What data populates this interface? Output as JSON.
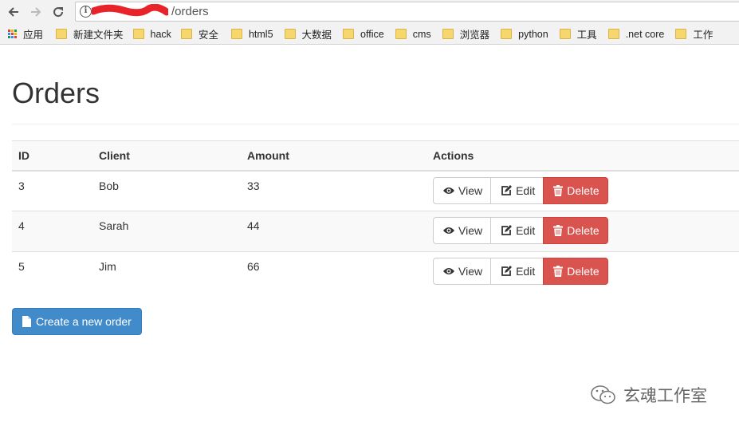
{
  "browser": {
    "url_path": "/orders",
    "bookmarks": [
      {
        "label": "应用",
        "icon": "apps-grid-icon"
      },
      {
        "label": "新建文件夹",
        "icon": "folder-icon"
      },
      {
        "label": "hack",
        "icon": "folder-icon"
      },
      {
        "label": "安全",
        "icon": "folder-icon"
      },
      {
        "label": "html5",
        "icon": "folder-icon"
      },
      {
        "label": "大数据",
        "icon": "folder-icon"
      },
      {
        "label": "office",
        "icon": "folder-icon"
      },
      {
        "label": "cms",
        "icon": "folder-icon"
      },
      {
        "label": "浏览器",
        "icon": "folder-icon"
      },
      {
        "label": "python",
        "icon": "folder-icon"
      },
      {
        "label": "工具",
        "icon": "folder-icon"
      },
      {
        "label": ".net core",
        "icon": "folder-icon"
      },
      {
        "label": "工作",
        "icon": "folder-icon"
      }
    ]
  },
  "page": {
    "title": "Orders",
    "table": {
      "headers": {
        "id": "ID",
        "client": "Client",
        "amount": "Amount",
        "actions": "Actions"
      },
      "rows": [
        {
          "id": "3",
          "client": "Bob",
          "amount": "33"
        },
        {
          "id": "4",
          "client": "Sarah",
          "amount": "44"
        },
        {
          "id": "5",
          "client": "Jim",
          "amount": "66"
        }
      ]
    },
    "actions": {
      "view": "View",
      "edit": "Edit",
      "delete": "Delete"
    },
    "create_button": "Create a new order"
  },
  "watermark": "玄魂工作室",
  "colors": {
    "primary": "#428bca",
    "danger": "#d9534f",
    "stripe": "#f9f9f9"
  }
}
